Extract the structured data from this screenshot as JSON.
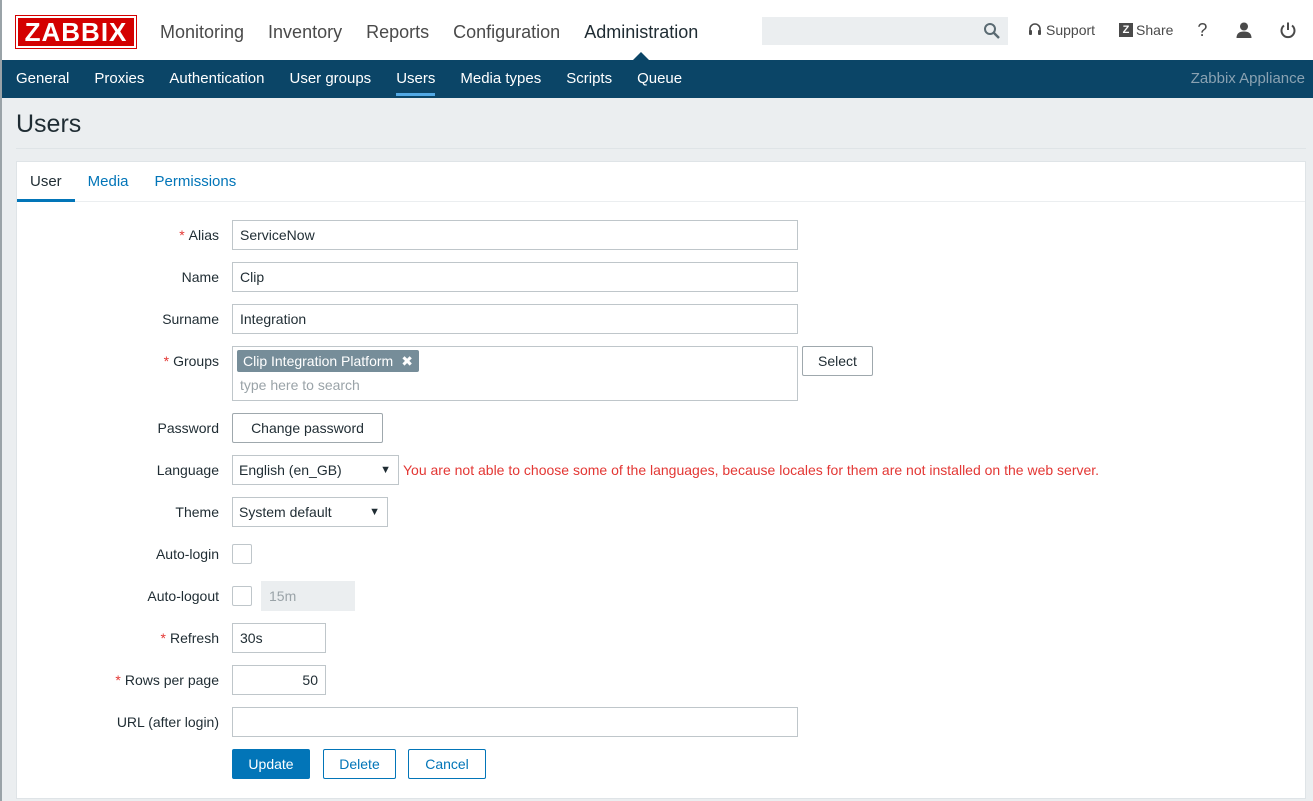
{
  "brand": {
    "logo_text": "ZABBIX",
    "color": "#d40000"
  },
  "main_nav": {
    "items": [
      {
        "label": "Monitoring"
      },
      {
        "label": "Inventory"
      },
      {
        "label": "Reports"
      },
      {
        "label": "Configuration"
      },
      {
        "label": "Administration",
        "active": true
      }
    ]
  },
  "search": {
    "value": "",
    "placeholder": ""
  },
  "top_links": {
    "support": "Support",
    "share": "Share",
    "help": "?",
    "share_icon_letter": "Z"
  },
  "sub_nav": {
    "items": [
      {
        "label": "General"
      },
      {
        "label": "Proxies"
      },
      {
        "label": "Authentication"
      },
      {
        "label": "User groups"
      },
      {
        "label": "Users",
        "active": true
      },
      {
        "label": "Media types"
      },
      {
        "label": "Scripts"
      },
      {
        "label": "Queue"
      }
    ],
    "appliance_label": "Zabbix Appliance",
    "background": "#0b4567"
  },
  "page": {
    "title": "Users"
  },
  "tabs": [
    {
      "label": "User",
      "active": true
    },
    {
      "label": "Media"
    },
    {
      "label": "Permissions"
    }
  ],
  "form": {
    "alias": {
      "label": "Alias",
      "value": "ServiceNow",
      "required": "*"
    },
    "name": {
      "label": "Name",
      "value": "Clip"
    },
    "surname": {
      "label": "Surname",
      "value": "Integration"
    },
    "groups": {
      "label": "Groups",
      "required": "*",
      "selected": "Clip Integration Platform",
      "remove_glyph": "✖",
      "placeholder": "type here to search",
      "select_button": "Select"
    },
    "password": {
      "label": "Password",
      "button": "Change password"
    },
    "language": {
      "label": "Language",
      "value": "English (en_GB)",
      "warning": "You are not able to choose some of the languages, because locales for them are not installed on the web server."
    },
    "theme": {
      "label": "Theme",
      "value": "System default"
    },
    "auto_login": {
      "label": "Auto-login",
      "checked": false
    },
    "auto_logout": {
      "label": "Auto-logout",
      "checked": false,
      "value": "15m"
    },
    "refresh": {
      "label": "Refresh",
      "value": "30s",
      "required": "*"
    },
    "rows_per_page": {
      "label": "Rows per page",
      "value": "50",
      "required": "*"
    },
    "url": {
      "label": "URL (after login)",
      "value": ""
    }
  },
  "actions": {
    "update": "Update",
    "delete": "Delete",
    "cancel": "Cancel"
  },
  "colors": {
    "accent": "#0275b8",
    "warning": "#e33734",
    "chip": "#768d99"
  }
}
